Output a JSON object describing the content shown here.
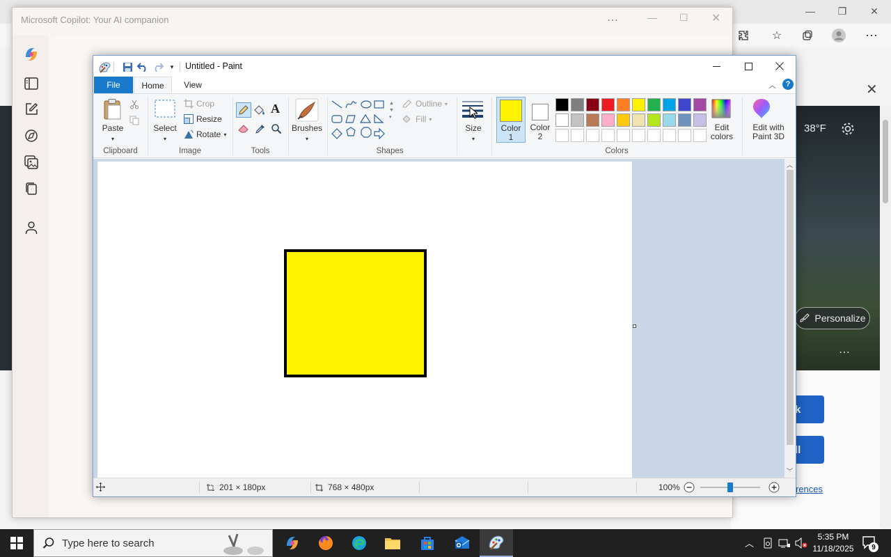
{
  "copilot": {
    "title": "Microsoft Copilot: Your AI companion"
  },
  "edge": {
    "temperature": "38°F",
    "personalize_label": "Personalize",
    "button_1_text": "k",
    "button_2_text": "ll",
    "prefs_link": "rences"
  },
  "paint": {
    "title": "Untitled - Paint",
    "tabs": {
      "file": "File",
      "home": "Home",
      "view": "View"
    },
    "clipboard": {
      "paste": "Paste",
      "group": "Clipboard"
    },
    "image": {
      "select": "Select",
      "crop": "Crop",
      "resize": "Resize",
      "rotate": "Rotate",
      "group": "Image"
    },
    "tools": {
      "group": "Tools"
    },
    "brushes": {
      "label": "Brushes"
    },
    "shapes": {
      "outline": "Outline",
      "fill": "Fill",
      "group": "Shapes"
    },
    "size": {
      "label": "Size"
    },
    "colors": {
      "color1_label": "Color",
      "color1_num": "1",
      "color2_label": "Color",
      "color2_num": "2",
      "edit_colors_1": "Edit",
      "edit_colors_2": "colors",
      "edit3d_1": "Edit with",
      "edit3d_2": "Paint 3D",
      "group": "Colors",
      "color1_value": "#fff200",
      "color2_value": "#ffffff",
      "palette_row1": [
        "#000000",
        "#7f7f7f",
        "#880015",
        "#ed1c24",
        "#ff7f27",
        "#fff200",
        "#22b14c",
        "#00a2e8",
        "#3f48cc",
        "#a349a4"
      ],
      "palette_row2": [
        "#ffffff",
        "#c3c3c3",
        "#b97a57",
        "#ffaec9",
        "#ffc90e",
        "#efe4b0",
        "#b5e61d",
        "#99d9ea",
        "#7092be",
        "#c8bfe7"
      ]
    },
    "canvas": {
      "shape_fill": "#fff200",
      "shape_stroke": "#000000"
    },
    "status": {
      "selection_size": "201 × 180px",
      "image_size": "768 × 480px",
      "zoom": "100%",
      "zoom_level": 100
    }
  },
  "taskbar": {
    "search_placeholder": "Type here to search",
    "time": "5:35 PM",
    "date": "11/18/2025",
    "notification_count": "9"
  }
}
